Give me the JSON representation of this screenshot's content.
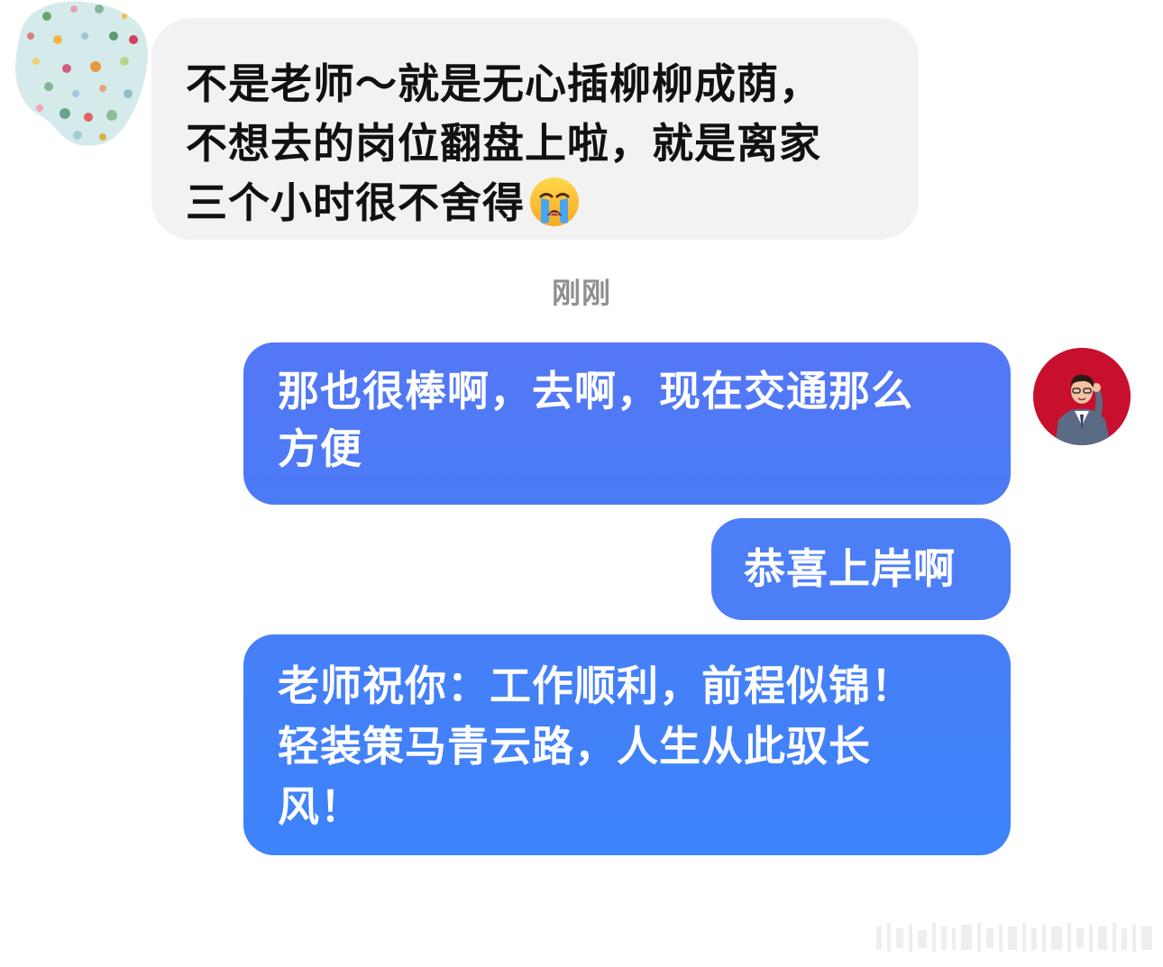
{
  "messages": [
    {
      "lines": [
        "不是老师～就是无心插柳柳成荫，",
        "不想去的岗位翻盘上啦，就是离家",
        "三个小时很不舍得"
      ],
      "emoji": "loudly-crying-face-icon"
    },
    {
      "lines": [
        "那也很棒啊，去啊，现在交通那么",
        "方便"
      ]
    },
    {
      "lines": [
        "恭喜上岸啊"
      ]
    },
    {
      "lines": [
        "老师祝你：工作顺利，前程似锦！",
        "轻装策马青云路，人生从此驭长",
        "风！"
      ]
    }
  ],
  "timestamp": "刚刚",
  "colors": {
    "incoming_bubble": "#f2f2f2",
    "outgoing_bubble": "#4c7ef6",
    "timestamp_text": "#8f8f8f",
    "avatar_right_bg": "#c8102e"
  },
  "icons": {
    "left_avatar": "polka-dot-avatar-icon",
    "right_avatar": "teacher-avatar-icon"
  }
}
